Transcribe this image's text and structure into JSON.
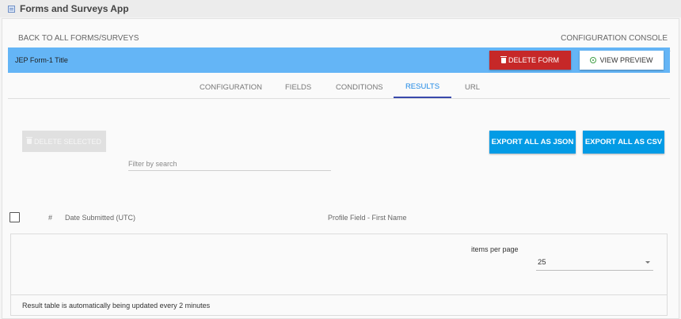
{
  "app": {
    "title": "Forms and Surveys App",
    "icon": "form-app-icon"
  },
  "topnav": {
    "back_label": "BACK TO ALL FORMS/SURVEYS",
    "console_label": "CONFIGURATION CONSOLE"
  },
  "form": {
    "title": "JEP Form-1 Title",
    "delete_label": "DELETE FORM",
    "preview_label": "VIEW PREVIEW",
    "bar_color": "#64b5f6",
    "delete_color": "#c62828"
  },
  "tabs": [
    {
      "label": "CONFIGURATION"
    },
    {
      "label": "FIELDS"
    },
    {
      "label": "CONDITIONS"
    },
    {
      "label": "RESULTS",
      "active": true
    },
    {
      "label": "URL"
    }
  ],
  "results": {
    "delete_selected_label": "DELETE SELECTED",
    "filter_placeholder": "Filter by search",
    "export_json_label": "EXPORT ALL AS JSON",
    "export_csv_label": "EXPORT ALL AS CSV",
    "export_color": "#039be5",
    "columns": [
      "#",
      "Date Submitted (UTC)",
      "Profile Field - First Name"
    ],
    "items_per_page_label": "items per page",
    "items_per_page_value": "25",
    "update_note": "Result table is automatically being updated every 2 minutes"
  }
}
